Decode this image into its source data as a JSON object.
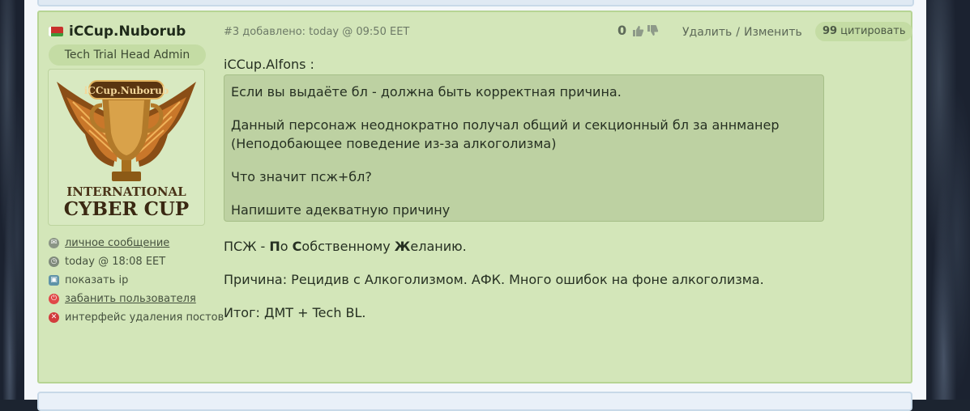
{
  "user": {
    "name": "iCCup.Nuborub",
    "role": "Tech Trial Head Admin",
    "avatar": {
      "banner": "iCCup.Nuborub",
      "line1": "INTERNATIONAL",
      "line2": "CYBER CUP"
    },
    "links": [
      {
        "icon": "mail-icon",
        "label": "личное сообщение",
        "link": true
      },
      {
        "icon": "clock-icon",
        "label": "today @ 18:08 EET",
        "link": false
      },
      {
        "icon": "monitor-icon",
        "label": "показать ip",
        "link": false
      },
      {
        "icon": "power-icon",
        "label": "забанить пользователя",
        "link": true
      },
      {
        "icon": "close-circle-icon",
        "label": "интерфейс удаления постов",
        "link": false
      }
    ]
  },
  "post": {
    "meta": "#3 добавлено: today @ 09:50 EET",
    "votes": "0",
    "delete_label": "Удалить",
    "separator": "/",
    "edit_label": "Изменить",
    "quote_icon": "99",
    "quote_label": "цитировать",
    "quote_author": "iCCup.Alfons :",
    "quote_paragraphs": [
      "Если вы выдаёте бл - должна быть корректная причина.",
      "Данный персонаж неоднократно получал общий и секционный бл за аннманер (Неподобающее поведение из-за алкоголизма)",
      "Что значит псж+бл?",
      "Напишите адекватную причину"
    ],
    "body": {
      "psj_prefix": "ПСЖ - ",
      "psj_w1_first": "П",
      "psj_w1_rest": "о ",
      "psj_w2_first": "С",
      "psj_w2_rest": "обственному ",
      "psj_w3_first": "Ж",
      "psj_w3_rest": "еланию.",
      "reason": "Причина: Рецидив с Алкоголизмом. АФК. Много ошибок на фоне алкоголизма.",
      "result": "Итог: ДМТ + Tech BL."
    }
  },
  "colors": {
    "post_bg": "#d3e6b9",
    "post_border": "#b6d494",
    "quote_bg": "#bdd1a2",
    "pill_bg": "#c4dca4",
    "ban_icon": "#e04848"
  }
}
